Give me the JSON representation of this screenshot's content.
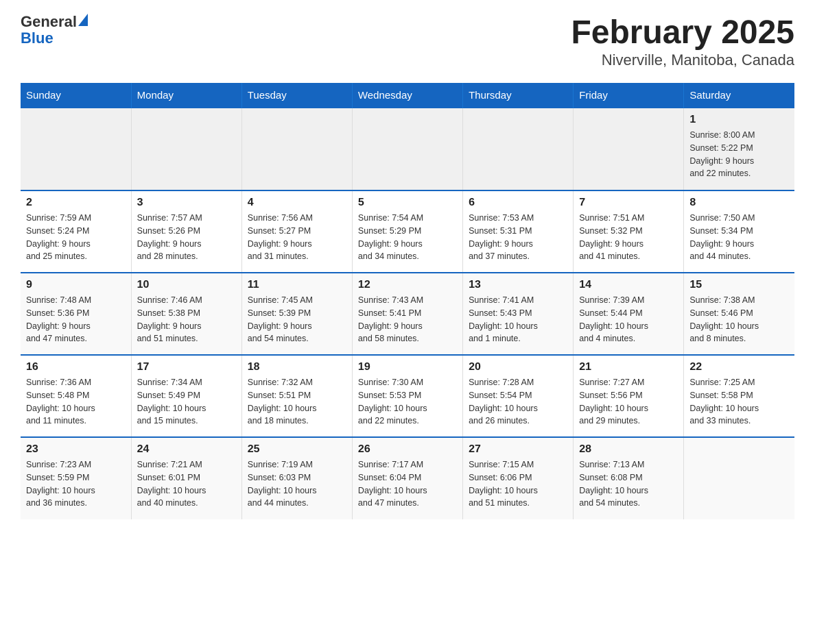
{
  "header": {
    "logo_line1": "General",
    "logo_line2": "Blue",
    "title": "February 2025",
    "subtitle": "Niverville, Manitoba, Canada"
  },
  "weekdays": [
    "Sunday",
    "Monday",
    "Tuesday",
    "Wednesday",
    "Thursday",
    "Friday",
    "Saturday"
  ],
  "weeks": [
    {
      "days": [
        {
          "num": "",
          "info": ""
        },
        {
          "num": "",
          "info": ""
        },
        {
          "num": "",
          "info": ""
        },
        {
          "num": "",
          "info": ""
        },
        {
          "num": "",
          "info": ""
        },
        {
          "num": "",
          "info": ""
        },
        {
          "num": "1",
          "info": "Sunrise: 8:00 AM\nSunset: 5:22 PM\nDaylight: 9 hours\nand 22 minutes."
        }
      ]
    },
    {
      "days": [
        {
          "num": "2",
          "info": "Sunrise: 7:59 AM\nSunset: 5:24 PM\nDaylight: 9 hours\nand 25 minutes."
        },
        {
          "num": "3",
          "info": "Sunrise: 7:57 AM\nSunset: 5:26 PM\nDaylight: 9 hours\nand 28 minutes."
        },
        {
          "num": "4",
          "info": "Sunrise: 7:56 AM\nSunset: 5:27 PM\nDaylight: 9 hours\nand 31 minutes."
        },
        {
          "num": "5",
          "info": "Sunrise: 7:54 AM\nSunset: 5:29 PM\nDaylight: 9 hours\nand 34 minutes."
        },
        {
          "num": "6",
          "info": "Sunrise: 7:53 AM\nSunset: 5:31 PM\nDaylight: 9 hours\nand 37 minutes."
        },
        {
          "num": "7",
          "info": "Sunrise: 7:51 AM\nSunset: 5:32 PM\nDaylight: 9 hours\nand 41 minutes."
        },
        {
          "num": "8",
          "info": "Sunrise: 7:50 AM\nSunset: 5:34 PM\nDaylight: 9 hours\nand 44 minutes."
        }
      ]
    },
    {
      "days": [
        {
          "num": "9",
          "info": "Sunrise: 7:48 AM\nSunset: 5:36 PM\nDaylight: 9 hours\nand 47 minutes."
        },
        {
          "num": "10",
          "info": "Sunrise: 7:46 AM\nSunset: 5:38 PM\nDaylight: 9 hours\nand 51 minutes."
        },
        {
          "num": "11",
          "info": "Sunrise: 7:45 AM\nSunset: 5:39 PM\nDaylight: 9 hours\nand 54 minutes."
        },
        {
          "num": "12",
          "info": "Sunrise: 7:43 AM\nSunset: 5:41 PM\nDaylight: 9 hours\nand 58 minutes."
        },
        {
          "num": "13",
          "info": "Sunrise: 7:41 AM\nSunset: 5:43 PM\nDaylight: 10 hours\nand 1 minute."
        },
        {
          "num": "14",
          "info": "Sunrise: 7:39 AM\nSunset: 5:44 PM\nDaylight: 10 hours\nand 4 minutes."
        },
        {
          "num": "15",
          "info": "Sunrise: 7:38 AM\nSunset: 5:46 PM\nDaylight: 10 hours\nand 8 minutes."
        }
      ]
    },
    {
      "days": [
        {
          "num": "16",
          "info": "Sunrise: 7:36 AM\nSunset: 5:48 PM\nDaylight: 10 hours\nand 11 minutes."
        },
        {
          "num": "17",
          "info": "Sunrise: 7:34 AM\nSunset: 5:49 PM\nDaylight: 10 hours\nand 15 minutes."
        },
        {
          "num": "18",
          "info": "Sunrise: 7:32 AM\nSunset: 5:51 PM\nDaylight: 10 hours\nand 18 minutes."
        },
        {
          "num": "19",
          "info": "Sunrise: 7:30 AM\nSunset: 5:53 PM\nDaylight: 10 hours\nand 22 minutes."
        },
        {
          "num": "20",
          "info": "Sunrise: 7:28 AM\nSunset: 5:54 PM\nDaylight: 10 hours\nand 26 minutes."
        },
        {
          "num": "21",
          "info": "Sunrise: 7:27 AM\nSunset: 5:56 PM\nDaylight: 10 hours\nand 29 minutes."
        },
        {
          "num": "22",
          "info": "Sunrise: 7:25 AM\nSunset: 5:58 PM\nDaylight: 10 hours\nand 33 minutes."
        }
      ]
    },
    {
      "days": [
        {
          "num": "23",
          "info": "Sunrise: 7:23 AM\nSunset: 5:59 PM\nDaylight: 10 hours\nand 36 minutes."
        },
        {
          "num": "24",
          "info": "Sunrise: 7:21 AM\nSunset: 6:01 PM\nDaylight: 10 hours\nand 40 minutes."
        },
        {
          "num": "25",
          "info": "Sunrise: 7:19 AM\nSunset: 6:03 PM\nDaylight: 10 hours\nand 44 minutes."
        },
        {
          "num": "26",
          "info": "Sunrise: 7:17 AM\nSunset: 6:04 PM\nDaylight: 10 hours\nand 47 minutes."
        },
        {
          "num": "27",
          "info": "Sunrise: 7:15 AM\nSunset: 6:06 PM\nDaylight: 10 hours\nand 51 minutes."
        },
        {
          "num": "28",
          "info": "Sunrise: 7:13 AM\nSunset: 6:08 PM\nDaylight: 10 hours\nand 54 minutes."
        },
        {
          "num": "",
          "info": ""
        }
      ]
    }
  ]
}
